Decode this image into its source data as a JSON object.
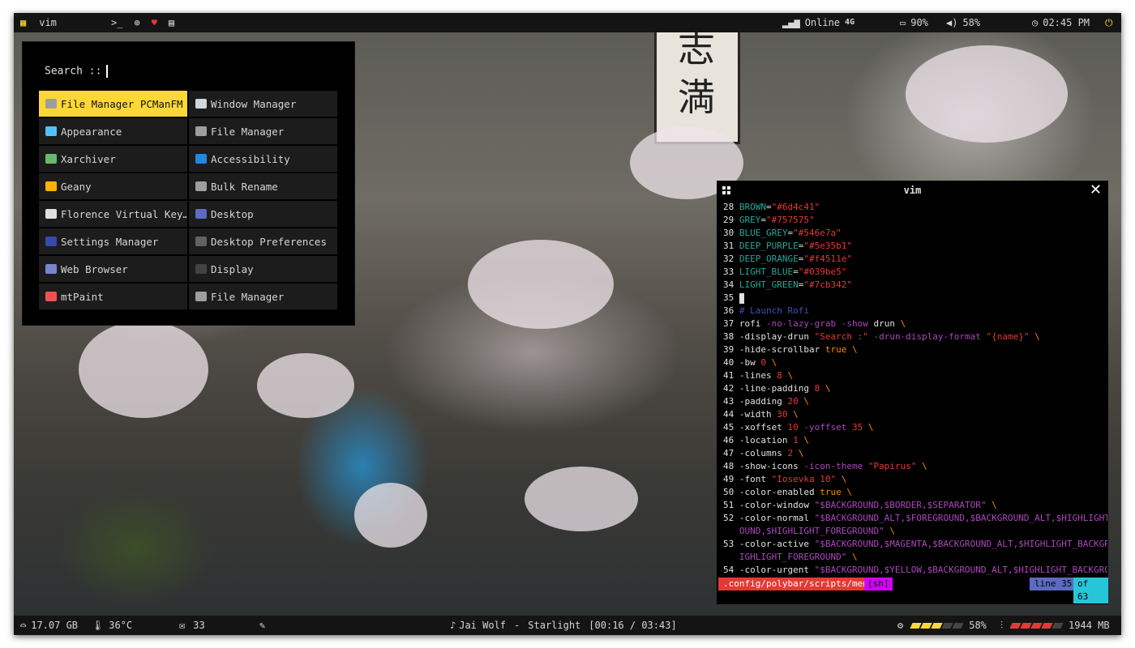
{
  "topbar": {
    "workspace_label": "vim",
    "network": {
      "status": "Online",
      "type": "4G"
    },
    "battery": "90%",
    "volume": "58%",
    "clock": "02:45 PM"
  },
  "rofi": {
    "search_label": "Search ::",
    "items": [
      {
        "label": "File Manager PCManFM",
        "icon": "file-manager-icon",
        "color": "#9e9e9e",
        "selected": true
      },
      {
        "label": "Window Manager",
        "icon": "window-manager-icon",
        "color": "#cfd8dc"
      },
      {
        "label": "Appearance",
        "icon": "appearance-icon",
        "color": "#4fc3f7"
      },
      {
        "label": "File Manager",
        "icon": "file-manager-icon",
        "color": "#9e9e9e"
      },
      {
        "label": "Xarchiver",
        "icon": "archive-icon",
        "color": "#66bb6a"
      },
      {
        "label": "Accessibility",
        "icon": "accessibility-icon",
        "color": "#1e88e5"
      },
      {
        "label": "Geany",
        "icon": "geany-icon",
        "color": "#ffb300"
      },
      {
        "label": "Bulk Rename",
        "icon": "rename-icon",
        "color": "#9e9e9e"
      },
      {
        "label": "Florence Virtual Key…",
        "icon": "keyboard-icon",
        "color": "#e0e0e0"
      },
      {
        "label": "Desktop",
        "icon": "desktop-icon",
        "color": "#5c6bc0"
      },
      {
        "label": "Settings Manager",
        "icon": "settings-icon",
        "color": "#3949ab"
      },
      {
        "label": "Desktop Preferences",
        "icon": "preferences-icon",
        "color": "#616161"
      },
      {
        "label": "Web Browser",
        "icon": "globe-icon",
        "color": "#7986cb"
      },
      {
        "label": "Display",
        "icon": "display-icon",
        "color": "#424242"
      },
      {
        "label": "mtPaint",
        "icon": "paint-icon",
        "color": "#ef5350"
      },
      {
        "label": "File Manager",
        "icon": "file-manager-icon",
        "color": "#9e9e9e"
      }
    ]
  },
  "vim": {
    "title": "vim",
    "lines": [
      {
        "n": "28",
        "parts": [
          [
            "var",
            "BROWN"
          ],
          [
            "txt",
            "="
          ],
          [
            "str",
            "\"#6d4c41\""
          ]
        ]
      },
      {
        "n": "29",
        "parts": [
          [
            "var",
            "GREY"
          ],
          [
            "txt",
            "="
          ],
          [
            "str",
            "\"#757575\""
          ]
        ]
      },
      {
        "n": "30",
        "parts": [
          [
            "var",
            "BLUE_GREY"
          ],
          [
            "txt",
            "="
          ],
          [
            "str",
            "\"#546e7a\""
          ]
        ]
      },
      {
        "n": "31",
        "parts": [
          [
            "var",
            "DEEP_PURPLE"
          ],
          [
            "txt",
            "="
          ],
          [
            "str",
            "\"#5e35b1\""
          ]
        ]
      },
      {
        "n": "32",
        "parts": [
          [
            "var",
            "DEEP_ORANGE"
          ],
          [
            "txt",
            "="
          ],
          [
            "str",
            "\"#f4511e\""
          ]
        ]
      },
      {
        "n": "33",
        "parts": [
          [
            "var",
            "LIGHT_BLUE"
          ],
          [
            "txt",
            "="
          ],
          [
            "str",
            "\"#039be5\""
          ]
        ]
      },
      {
        "n": "34",
        "parts": [
          [
            "var",
            "LIGHT_GREEN"
          ],
          [
            "txt",
            "="
          ],
          [
            "str",
            "\"#7cb342\""
          ]
        ]
      },
      {
        "n": "35",
        "parts": [
          [
            "cur",
            ""
          ]
        ]
      },
      {
        "n": "36",
        "parts": [
          [
            "cmt",
            "# Launch Rofi"
          ]
        ]
      },
      {
        "n": "37",
        "parts": [
          [
            "txt",
            "rofi "
          ],
          [
            "opt",
            "-no-lazy-grab -show"
          ],
          [
            "txt",
            " drun "
          ],
          [
            "bs",
            "\\"
          ]
        ]
      },
      {
        "n": "38",
        "parts": [
          [
            "txt",
            "-display-drun "
          ],
          [
            "str",
            "\"Search :\""
          ],
          [
            "opt",
            " -drun-display-format "
          ],
          [
            "str",
            "\"{name}\""
          ],
          [
            "txt",
            " "
          ],
          [
            "bs",
            "\\"
          ]
        ]
      },
      {
        "n": "39",
        "parts": [
          [
            "txt",
            "-hide-scrollbar "
          ],
          [
            "kw",
            "true"
          ],
          [
            "txt",
            " "
          ],
          [
            "bs",
            "\\"
          ]
        ]
      },
      {
        "n": "40",
        "parts": [
          [
            "txt",
            "-bw "
          ],
          [
            "num",
            "0"
          ],
          [
            "txt",
            " "
          ],
          [
            "bs",
            "\\"
          ]
        ]
      },
      {
        "n": "41",
        "parts": [
          [
            "txt",
            "-lines "
          ],
          [
            "num",
            "8"
          ],
          [
            "txt",
            " "
          ],
          [
            "bs",
            "\\"
          ]
        ]
      },
      {
        "n": "42",
        "parts": [
          [
            "txt",
            "-line-padding "
          ],
          [
            "num",
            "8"
          ],
          [
            "txt",
            " "
          ],
          [
            "bs",
            "\\"
          ]
        ]
      },
      {
        "n": "43",
        "parts": [
          [
            "txt",
            "-padding "
          ],
          [
            "num",
            "20"
          ],
          [
            "txt",
            " "
          ],
          [
            "bs",
            "\\"
          ]
        ]
      },
      {
        "n": "44",
        "parts": [
          [
            "txt",
            "-width "
          ],
          [
            "num",
            "30"
          ],
          [
            "txt",
            " "
          ],
          [
            "bs",
            "\\"
          ]
        ]
      },
      {
        "n": "45",
        "parts": [
          [
            "txt",
            "-xoffset "
          ],
          [
            "num",
            "10"
          ],
          [
            "opt",
            " -yoffset "
          ],
          [
            "num",
            "35"
          ],
          [
            "txt",
            " "
          ],
          [
            "bs",
            "\\"
          ]
        ]
      },
      {
        "n": "46",
        "parts": [
          [
            "txt",
            "-location "
          ],
          [
            "num",
            "1"
          ],
          [
            "txt",
            " "
          ],
          [
            "bs",
            "\\"
          ]
        ]
      },
      {
        "n": "47",
        "parts": [
          [
            "txt",
            "-columns "
          ],
          [
            "num",
            "2"
          ],
          [
            "txt",
            " "
          ],
          [
            "bs",
            "\\"
          ]
        ]
      },
      {
        "n": "48",
        "parts": [
          [
            "txt",
            "-show-icons "
          ],
          [
            "opt",
            "-icon-theme "
          ],
          [
            "str",
            "\"Papirus\""
          ],
          [
            "txt",
            " "
          ],
          [
            "bs",
            "\\"
          ]
        ]
      },
      {
        "n": "49",
        "parts": [
          [
            "txt",
            "-font "
          ],
          [
            "str",
            "\"Iosevka 10\""
          ],
          [
            "txt",
            " "
          ],
          [
            "bs",
            "\\"
          ]
        ]
      },
      {
        "n": "50",
        "parts": [
          [
            "txt",
            "-color-enabled "
          ],
          [
            "kw",
            "true"
          ],
          [
            "txt",
            " "
          ],
          [
            "bs",
            "\\"
          ]
        ]
      },
      {
        "n": "51",
        "parts": [
          [
            "txt",
            "-color-window "
          ],
          [
            "opt",
            "\"$BACKGROUND,$BORDER,$SEPARATOR\""
          ],
          [
            "txt",
            " "
          ],
          [
            "bs",
            "\\"
          ]
        ]
      },
      {
        "n": "52",
        "parts": [
          [
            "txt",
            "-color-normal "
          ],
          [
            "opt",
            "\"$BACKGROUND_ALT,$FOREGROUND,$BACKGROUND_ALT,$HIGHLIGHT_BACKGR"
          ]
        ]
      },
      {
        "n": "",
        "parts": [
          [
            "opt",
            "OUND,$HIGHLIGHT_FOREGROUND\""
          ],
          [
            "txt",
            " "
          ],
          [
            "bs",
            "\\"
          ]
        ]
      },
      {
        "n": "53",
        "parts": [
          [
            "txt",
            "-color-active "
          ],
          [
            "opt",
            "\"$BACKGROUND,$MAGENTA,$BACKGROUND_ALT,$HIGHLIGHT_BACKGROUND,$H"
          ]
        ]
      },
      {
        "n": "",
        "parts": [
          [
            "opt",
            "IGHLIGHT_FOREGROUND\""
          ],
          [
            "txt",
            " "
          ],
          [
            "bs",
            "\\"
          ]
        ]
      },
      {
        "n": "54",
        "parts": [
          [
            "txt",
            "-color-urgent "
          ],
          [
            "opt",
            "\"$BACKGROUND,$YELLOW,$BACKGROUND_ALT,$HIGHLIGHT_BACKGROUND,"
          ],
          [
            "cmt",
            "@@@"
          ]
        ]
      }
    ],
    "status": {
      "path": ".config/polybar/scripts/menu",
      "filetype": "[sh]",
      "line": "line 35",
      "of": "of 63"
    }
  },
  "bottombar": {
    "disk": "17.07 GB",
    "temp": "36°C",
    "mail": "33",
    "music": {
      "artist": "Jai Wolf",
      "sep": "-",
      "title": "Starlight",
      "time": "[00:16 / 03:43]"
    },
    "cpu": "58%",
    "memory": "1944 MB"
  }
}
